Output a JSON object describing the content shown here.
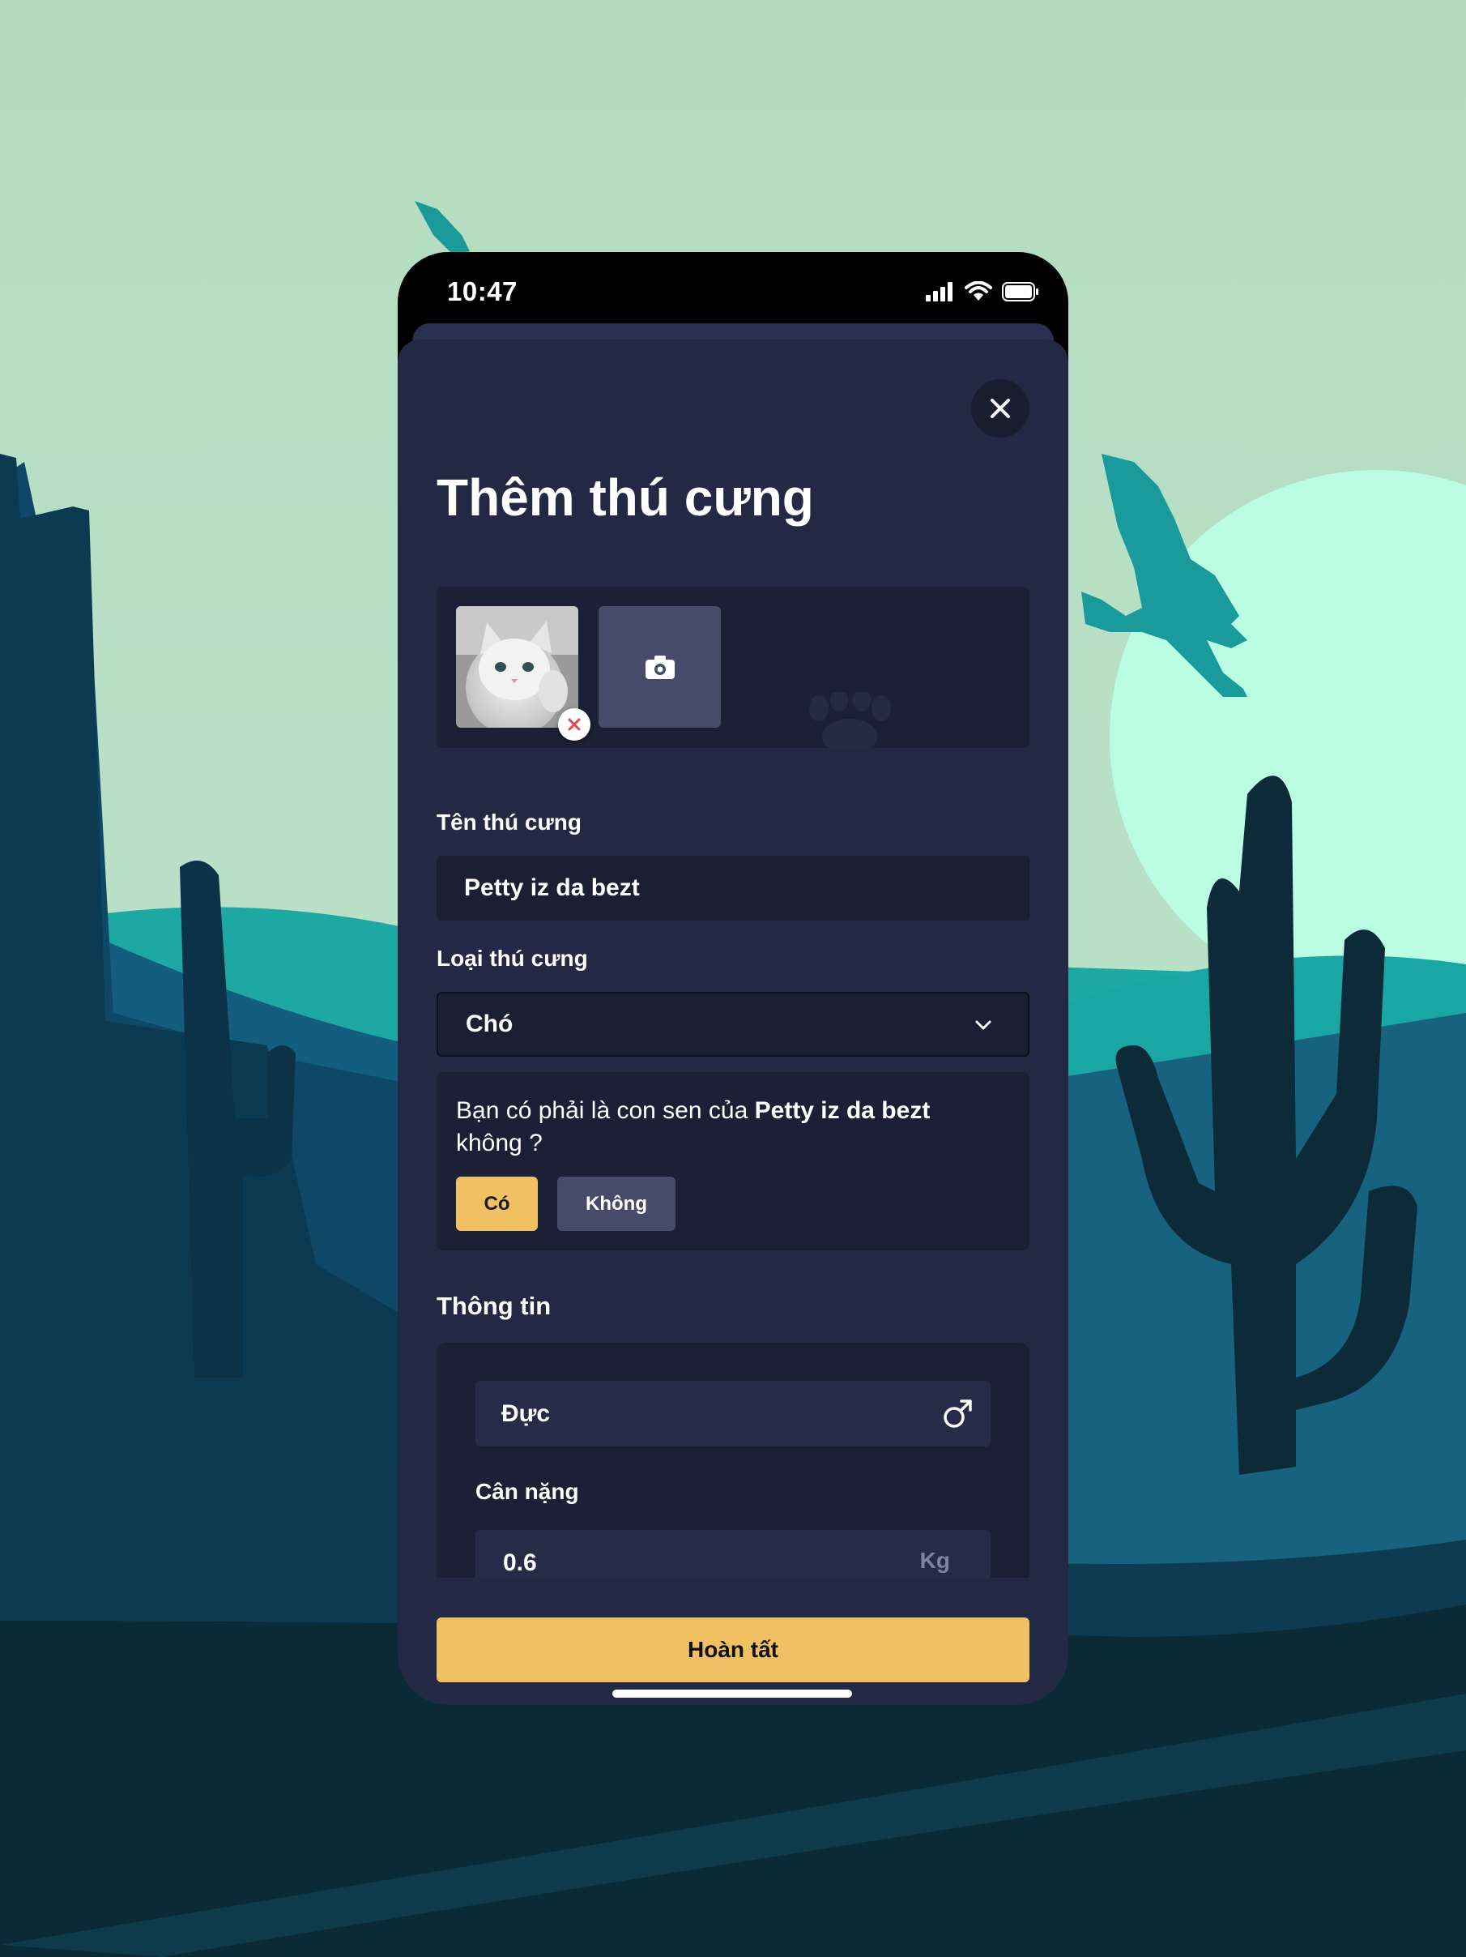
{
  "status_bar": {
    "time": "10:47"
  },
  "form": {
    "title": "Thêm thú cưng",
    "pet_name_label": "Tên thú cưng",
    "pet_name_value": "Petty iz da bezt",
    "pet_type_label": "Loại thú cưng",
    "pet_type_value": "Chó",
    "confirm": {
      "prefix": "Bạn có phải là con sen của ",
      "pet_name": "Petty iz da bezt",
      "suffix": "không ?",
      "yes_label": "Có",
      "no_label": "Không"
    },
    "info_title": "Thông tin",
    "gender_value": "Đực",
    "weight_label": "Cân nặng",
    "weight_value": "0.6",
    "weight_unit": "Kg",
    "submit_label": "Hoàn tất"
  },
  "icons": {
    "close": "close-icon",
    "remove_photo": "remove-photo-icon",
    "camera": "camera-icon",
    "chevron": "chevron-down-icon",
    "gender": "male-icon"
  },
  "colors": {
    "sheet": "#232944",
    "field": "#1b1f34",
    "accent": "#f1c063",
    "muted_button": "#454b68",
    "sky": "#b3dcc0",
    "sun": "#bafde3"
  }
}
